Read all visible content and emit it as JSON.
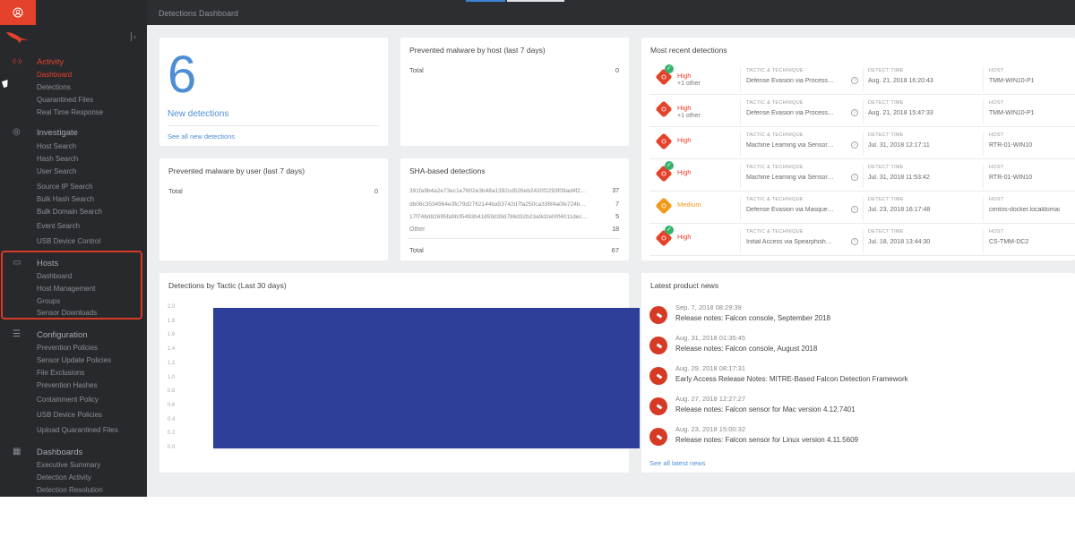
{
  "topbar": {
    "title": "Detections Dashboard"
  },
  "colors": {
    "accent": "#e5422b",
    "blue": "#4e8ed6",
    "chart_bar": "#2e3f99",
    "sidebar_bg": "#27292d",
    "high": "#e5422b",
    "medium": "#f19a18"
  },
  "sidebar": {
    "sections": [
      {
        "label": "Activity",
        "icon": "activity-icon",
        "active": true,
        "items": [
          {
            "label": "Dashboard",
            "active": true
          },
          {
            "label": "Detections"
          },
          {
            "label": "Quarantined Files"
          },
          {
            "label": "Real Time Response"
          }
        ]
      },
      {
        "label": "Investigate",
        "icon": "search-icon",
        "items": [
          {
            "label": "Host Search"
          },
          {
            "label": "Hash Search"
          },
          {
            "label": "User Search"
          },
          {
            "label": "Source IP Search"
          },
          {
            "label": "Bulk Hash Search"
          },
          {
            "label": "Bulk Domain Search"
          },
          {
            "label": "Event Search"
          },
          {
            "label": "USB Device Control"
          }
        ]
      },
      {
        "label": "Hosts",
        "icon": "monitor-icon",
        "items": [
          {
            "label": "Dashboard"
          },
          {
            "label": "Host Management"
          },
          {
            "label": "Groups"
          },
          {
            "label": "Sensor Downloads"
          }
        ]
      },
      {
        "label": "Configuration",
        "icon": "sliders-icon",
        "items": [
          {
            "label": "Prevention Policies"
          },
          {
            "label": "Sensor Update Policies"
          },
          {
            "label": "File Exclusions"
          },
          {
            "label": "Prevention Hashes"
          },
          {
            "label": "Containment Policy"
          },
          {
            "label": "USB Device Policies"
          },
          {
            "label": "Upload Quarantined Files"
          }
        ]
      },
      {
        "label": "Dashboards",
        "icon": "dashboard-icon",
        "items": [
          {
            "label": "Executive Summary"
          },
          {
            "label": "Detection Activity"
          },
          {
            "label": "Detection Resolution"
          }
        ]
      }
    ]
  },
  "new_detections": {
    "count": "6",
    "label": "New detections",
    "link": "See all new detections"
  },
  "malware_by_host": {
    "title": "Prevented malware by host (last 7 days)",
    "total_label": "Total",
    "total_value": "0"
  },
  "malware_by_user": {
    "title": "Prevented malware by user (last 7 days)",
    "total_label": "Total",
    "total_value": "0"
  },
  "sha_detections": {
    "title": "SHA-based detections",
    "rows": [
      {
        "hash": "391fa9b4a2e73ec1e7602e3b48a1392cd526eb2430f2293f09ad4f2…",
        "count": "37"
      },
      {
        "hash": "db06c3534964e3fc79d2762144ba53742d7fa250ca336f4a0fe724b…",
        "count": "7"
      },
      {
        "hash": "17f746d82695fa9b35493b41859d39d786d32b23a9d2e00f4011dec…",
        "count": "5"
      },
      {
        "hash": "Other",
        "count": "18"
      }
    ],
    "total_label": "Total",
    "total_value": "67"
  },
  "recent_detections": {
    "title": "Most recent detections",
    "col_tactic": "TACTIC & TECHNIQUE",
    "col_time": "DETECT TIME",
    "col_host": "HOST",
    "rows": [
      {
        "severity": "High",
        "other": "+1 other",
        "check": true,
        "tactic": "Defense Evasion via Process…",
        "time": "Aug. 21, 2018 16:20:43",
        "host": "TMM-WIN10-P1"
      },
      {
        "severity": "High",
        "other": "+1 other",
        "check": false,
        "tactic": "Defense Evasion via Process…",
        "time": "Aug. 21, 2018 15:47:33",
        "host": "TMM-WIN10-P1"
      },
      {
        "severity": "High",
        "other": "",
        "check": false,
        "tactic": "Machine Learning via Sensor…",
        "time": "Jul. 31, 2018 12:17:11",
        "host": "RTR-01-WIN10"
      },
      {
        "severity": "High",
        "other": "",
        "check": true,
        "tactic": "Machine Learning via Sensor…",
        "time": "Jul. 31, 2018 11:53:42",
        "host": "RTR-01-WIN10"
      },
      {
        "severity": "Medium",
        "other": "",
        "check": false,
        "tactic": "Defense Evasion via Masque…",
        "time": "Jul. 23, 2018 16:17:48",
        "host": "centos-docker.localdomai"
      },
      {
        "severity": "High",
        "other": "",
        "check": true,
        "tactic": "Initial Access via Spearphish…",
        "time": "Jul. 18, 2018 13:44:30",
        "host": "CS-TMM-DC2"
      }
    ]
  },
  "chart_data": {
    "type": "bar",
    "title": "Detections by Tactic (Last 30 days)",
    "categories": [
      ""
    ],
    "values": [
      2.0
    ],
    "ylim": [
      0,
      2.0
    ],
    "yticks": [
      "2.0",
      "1.8",
      "1.6",
      "1.4",
      "1.2",
      "1.0",
      "0.8",
      "0.6",
      "0.4",
      "0.2",
      "0.0"
    ],
    "grid": true,
    "xlabel": "",
    "ylabel": ""
  },
  "news": {
    "title": "Latest product news",
    "link": "See all latest news",
    "items": [
      {
        "date": "Sep. 7, 2018 08:29:39",
        "title": "Release notes: Falcon console, September 2018"
      },
      {
        "date": "Aug. 31, 2018 01:35:45",
        "title": "Release notes: Falcon console, August 2018"
      },
      {
        "date": "Aug. 29, 2018 08:17:31",
        "title": "Early Access Release Notes: MITRE-Based Falcon Detection Framework"
      },
      {
        "date": "Aug. 27, 2018 12:27:27",
        "title": "Release notes: Falcon sensor for Mac version 4.12.7401"
      },
      {
        "date": "Aug. 23, 2018 15:00:32",
        "title": "Release notes: Falcon sensor for Linux version 4.11.5609"
      }
    ]
  }
}
